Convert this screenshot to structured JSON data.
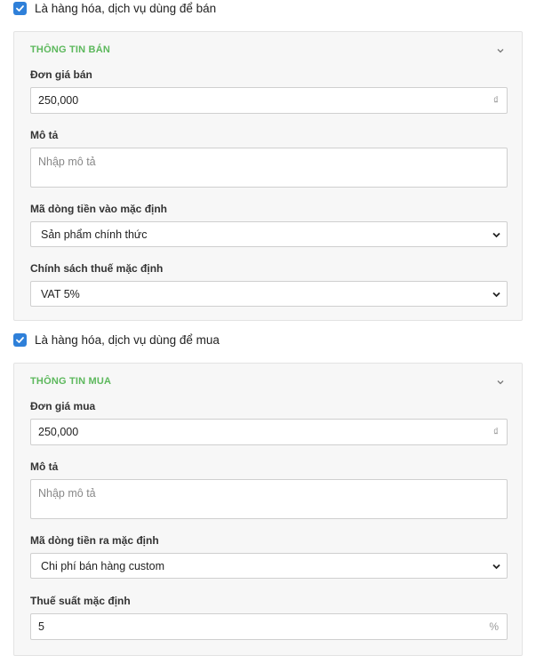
{
  "sell_toggle": {
    "label": "Là hàng hóa, dịch vụ dùng để bán",
    "checked": true
  },
  "sell_panel": {
    "title": "THÔNG TIN BÁN",
    "price": {
      "label": "Đơn giá bán",
      "value": "250,000",
      "suffix": "₫"
    },
    "description": {
      "label": "Mô tả",
      "placeholder": "Nhập mô tả"
    },
    "cashflow": {
      "label": "Mã dòng tiền vào mặc định",
      "selected": "Sản phẩm chính thức"
    },
    "tax_policy": {
      "label": "Chính sách thuế mặc định",
      "selected": "VAT 5%"
    }
  },
  "buy_toggle": {
    "label": "Là hàng hóa, dịch vụ dùng để mua",
    "checked": true
  },
  "buy_panel": {
    "title": "THÔNG TIN MUA",
    "price": {
      "label": "Đơn giá mua",
      "value": "250,000",
      "suffix": "₫"
    },
    "description": {
      "label": "Mô tả",
      "placeholder": "Nhập mô tả"
    },
    "cashflow": {
      "label": "Mã dòng tiền ra mặc định",
      "selected": "Chi phí bán hàng custom"
    },
    "tax_rate": {
      "label": "Thuế suất mặc định",
      "value": "5",
      "suffix": "%"
    }
  },
  "colors": {
    "accent_green": "#5cb85c",
    "checkbox_blue": "#2f80d9"
  },
  "icons": {
    "checkbox": "checkmark-icon",
    "collapse": "chevron-down-icon",
    "select": "chevron-down-icon"
  }
}
